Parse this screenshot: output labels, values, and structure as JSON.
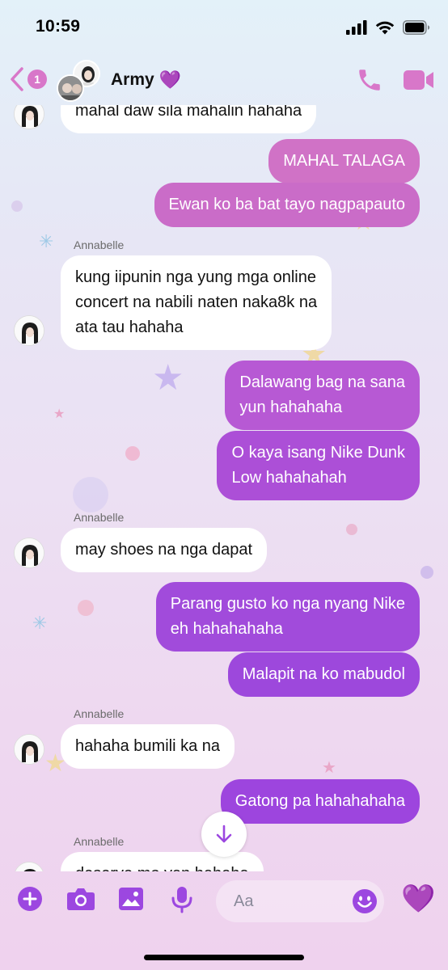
{
  "status_bar": {
    "time": "10:59",
    "icons": [
      "signal-icon",
      "wifi-icon",
      "battery-icon"
    ]
  },
  "header": {
    "back_icon": "chevron-left-icon",
    "unread_count": "1",
    "title": "Army",
    "title_emoji": "💜",
    "call_icon": "phone-icon",
    "video_icon": "video-camera-icon"
  },
  "colors": {
    "accent": "#d877c9",
    "out_top": "#d374c8",
    "out_mid": "#b85bd4",
    "out_bottom": "#9c44dd",
    "icon_purple": "#9c47e0"
  },
  "messages": [
    {
      "dir": "in",
      "text": "mahal daw sila mahalin hahaha"
    },
    {
      "dir": "out",
      "text": "MAHAL TALAGA"
    },
    {
      "dir": "out",
      "text": "Ewan ko ba bat tayo nagpapauto"
    },
    {
      "dir": "in",
      "sender": "Annabelle",
      "lines": [
        "kung iipunin nga yung mga online",
        "concert na nabili naten naka8k na",
        "ata tau hahaha"
      ]
    },
    {
      "dir": "out",
      "lines": [
        "Dalawang bag na sana",
        "yun hahahaha"
      ]
    },
    {
      "dir": "out",
      "lines": [
        "O kaya isang Nike Dunk",
        "Low hahahahah"
      ]
    },
    {
      "dir": "in",
      "sender": "Annabelle",
      "text": "may shoes na nga dapat"
    },
    {
      "dir": "out",
      "lines": [
        "Parang gusto ko nga nyang Nike",
        "eh hahahahaha"
      ]
    },
    {
      "dir": "out",
      "text": "Malapit na ko mabudol"
    },
    {
      "dir": "in",
      "sender": "Annabelle",
      "text": "hahaha bumili ka na"
    },
    {
      "dir": "out",
      "text": "Gatong pa hahahahaha"
    },
    {
      "dir": "in",
      "sender": "Annabelle",
      "text": "deserve mo yan hahaha"
    }
  ],
  "scroll_down_icon": "arrow-down-icon",
  "composer": {
    "placeholder": "Aa",
    "icons": [
      "plus-icon",
      "camera-icon",
      "image-icon",
      "microphone-icon",
      "emoji-icon",
      "heart-icon"
    ],
    "like_emoji": "💜"
  }
}
